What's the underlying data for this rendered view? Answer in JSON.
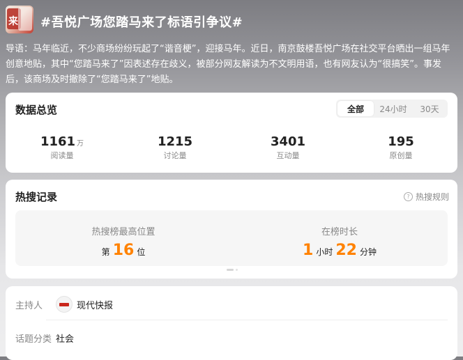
{
  "topic": {
    "title": "#吾悦广场您踏马来了标语引争议#",
    "intro": "导语：马年临近，不少商场纷纷玩起了“谐音梗”，迎接马年。近日，南京鼓楼吾悦广场在社交平台晒出一组马年创意地贴，其中“您踏马来了”因表述存在歧义，被部分网友解读为不文明用语，也有网友认为“很搞笑”。事发后，该商场及时撤除了“您踏马来了”地贴。"
  },
  "overview": {
    "title": "数据总览",
    "tabs": [
      "全部",
      "24小时",
      "30天"
    ],
    "active_tab": "全部",
    "stats": [
      {
        "value": "1161",
        "unit": "万",
        "label": "阅读量"
      },
      {
        "value": "1215",
        "unit": "",
        "label": "讨论量"
      },
      {
        "value": "3401",
        "unit": "",
        "label": "互动量"
      },
      {
        "value": "195",
        "unit": "",
        "label": "原创量"
      }
    ]
  },
  "hot": {
    "title": "热搜记录",
    "rule_label": "热搜规则",
    "peak": {
      "label": "热搜榜最高位置",
      "prefix": "第",
      "value": "16",
      "suffix": "位"
    },
    "duration": {
      "label": "在榜时长",
      "hours": "1",
      "hours_unit": "小时",
      "minutes": "22",
      "minutes_unit": "分钟"
    }
  },
  "info": {
    "host_label": "主持人",
    "host_name": "现代快报",
    "category_label": "话题分类",
    "category": "社会"
  },
  "colors": {
    "accent": "#ff8200",
    "card": "#ffffff",
    "muted": "#888888"
  }
}
